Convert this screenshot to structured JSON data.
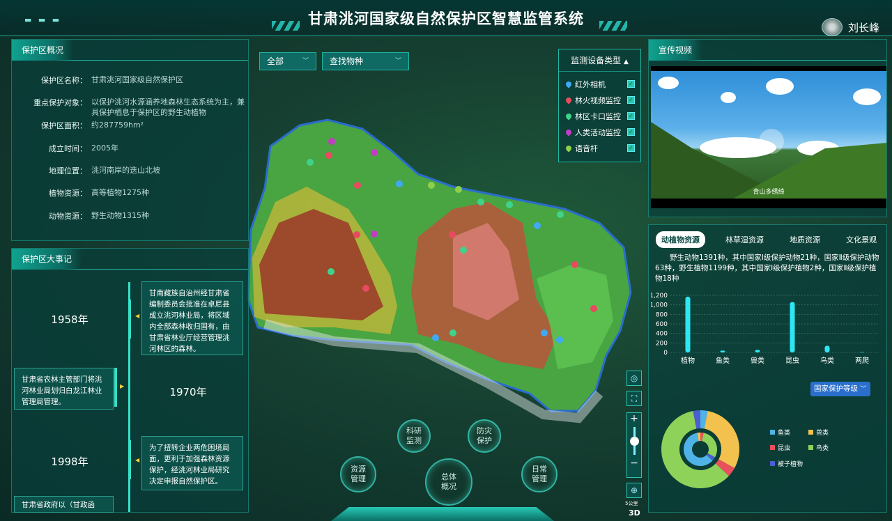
{
  "header": {
    "title": "甘肃洮河国家级自然保护区智慧监管系统",
    "user_name": "刘长峰"
  },
  "overview": {
    "title": "保护区概况",
    "rows": [
      {
        "label": "保护区名称：",
        "value": "甘肃洮河国家级自然保护区"
      },
      {
        "label": "重点保护对象：",
        "value": "以保护洮河水源涵养地森林生态系统为主，兼具保护栖息于保护区的野生动植物"
      },
      {
        "label": "保护区面积：",
        "value": "约287759hm²"
      },
      {
        "label": "成立时间：",
        "value": "2005年"
      },
      {
        "label": "地理位置：",
        "value": "洮河南岸的迭山北坡"
      },
      {
        "label": "植物资源：",
        "value": "高等植物1275种"
      },
      {
        "label": "动物资源：",
        "value": "野生动物1315种"
      }
    ]
  },
  "events": {
    "title": "保护区大事记",
    "items": [
      {
        "year": "1958年",
        "text": "甘南藏族自治州经甘肃省编制委员会批准在卓尼县成立洮河林业局，将区域内全部森林收归国有，由甘肃省林业厅经营管理洮河林区的森林。"
      },
      {
        "year": "1970年",
        "text": "甘肃省农林主管部门将洮河林业局划归白龙江林业管理局管理。"
      },
      {
        "year": "1998年",
        "text": "为了扭转企业两危困境局面，更利于加强森林资源保护，经洮河林业局研究决定申报自然保护区。"
      },
      {
        "year": "",
        "text": "甘肃省政府以（甘政函"
      }
    ]
  },
  "map_filters": {
    "region": "全部",
    "species_placeholder": "查找物种"
  },
  "devices": {
    "title": "监测设备类型",
    "items": [
      {
        "label": "红外相机",
        "color": "#3fa9f5"
      },
      {
        "label": "林火视频监控",
        "color": "#e84a5f"
      },
      {
        "label": "林区卡口监控",
        "color": "#3fd28a"
      },
      {
        "label": "人类活动监控",
        "color": "#c33cc4"
      },
      {
        "label": "语音杆",
        "color": "#8fd04a"
      }
    ]
  },
  "video": {
    "title": "宣传视频",
    "caption": "青山多绣绮"
  },
  "resources": {
    "tabs": [
      "动植物资源",
      "林草湿资源",
      "地质资源",
      "文化景观"
    ],
    "active_tab": "动植物资源",
    "summary": "野生动物1391种，其中国家Ⅰ级保护动物21种，国家Ⅱ级保护动物63种，野生植物1199种，其中国家Ⅰ级保护植物2种，国家Ⅱ级保护植物18种",
    "protect_select": "国家保护等级"
  },
  "chart_data": [
    {
      "type": "bar",
      "categories": [
        "植物",
        "鱼类",
        "兽类",
        "昆虫",
        "鸟类",
        "两爬"
      ],
      "values": [
        1170,
        40,
        55,
        1060,
        140,
        10
      ],
      "ylim": [
        0,
        1200
      ],
      "yticks": [
        "0",
        "200",
        "400",
        "600",
        "800",
        "1,000",
        "1,200"
      ],
      "grid": true,
      "color": "#2ee6f2"
    },
    {
      "type": "pie",
      "legend": [
        "鱼类",
        "兽类",
        "昆虫",
        "鸟类",
        "被子植物"
      ],
      "colors": [
        "#4fb3e8",
        "#f2c14e",
        "#e8505b",
        "#8ed25a",
        "#4b5fd0"
      ],
      "values": [
        3,
        30,
        4,
        60,
        3
      ]
    }
  ],
  "nav": {
    "items": [
      "科研监测",
      "防灾保护",
      "资源管理",
      "总体概况",
      "日常管理"
    ]
  },
  "map_tools": {
    "scale": "5公里",
    "mode": "3D"
  }
}
